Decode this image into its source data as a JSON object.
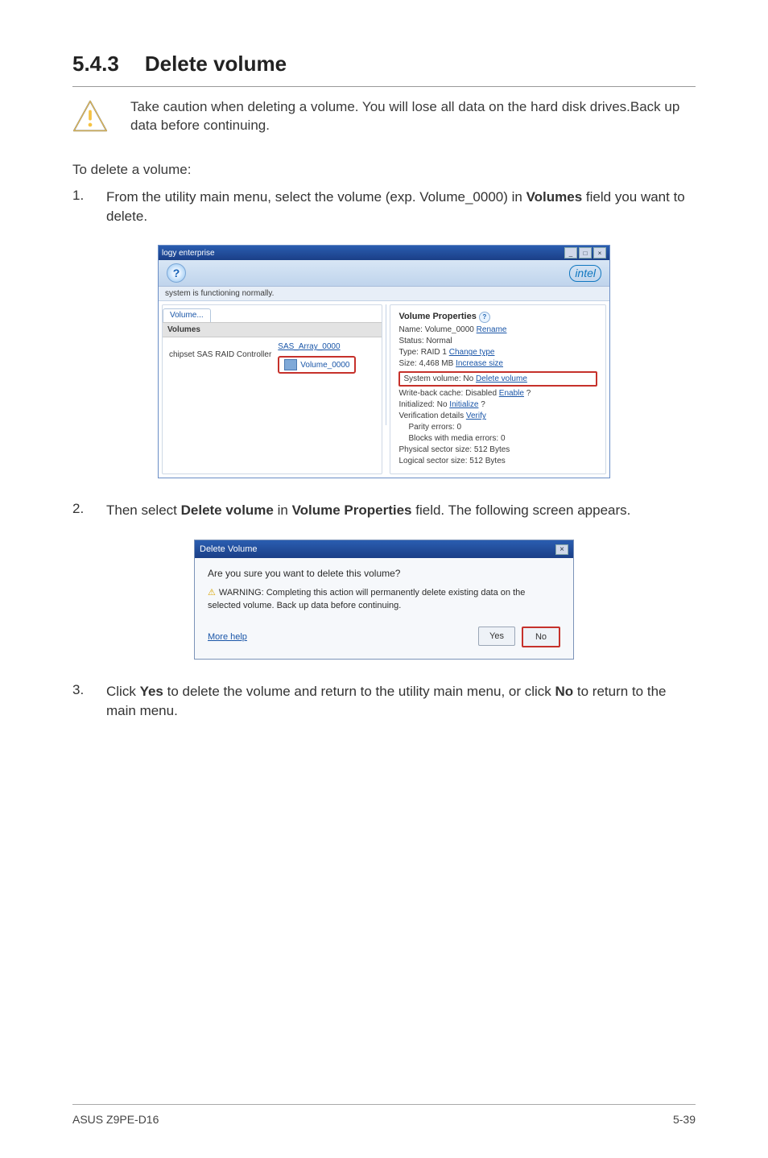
{
  "section": {
    "number": "5.4.3",
    "title": "Delete volume"
  },
  "note": {
    "text": "Take caution when deleting a volume. You will lose all data on the hard disk drives.Back up data before continuing."
  },
  "intro": "To delete a volume:",
  "step1": {
    "num": "1.",
    "text_pre": "From the utility main menu, select the volume (exp. Volume_0000) in ",
    "bold": "Volumes",
    "text_post": " field you want to delete."
  },
  "screenshot1": {
    "title": "logy enterprise",
    "brand": "intel",
    "status": "system is functioning normally.",
    "tab": "Volume...",
    "volumes_header": "Volumes",
    "controller_label": "chipset SAS RAID Controller",
    "array_link": "SAS_Array_0000",
    "volume_chip": "Volume_0000",
    "props": {
      "title": "Volume Properties",
      "name_label": "Name:",
      "name_value": "Volume_0000",
      "rename": "Rename",
      "status_label": "Status:",
      "status_value": "Normal",
      "type_label": "Type:",
      "type_value": "RAID 1",
      "change_type": "Change type",
      "size_label": "Size:",
      "size_value": "4,468 MB",
      "increase_size": "Increase size",
      "sysvol_label": "System volume:",
      "sysvol_value": "No",
      "delete_volume": "Delete volume",
      "wbc_label": "Write-back cache:",
      "wbc_value": "Disabled",
      "enable": "Enable",
      "init_label": "Initialized:",
      "init_value": "No",
      "initialize": "Initialize",
      "verif_label": "Verification details",
      "verify": "Verify",
      "parity": "Parity errors: 0",
      "blocks": "Blocks with media errors: 0",
      "phys": "Physical sector size: 512 Bytes",
      "log": "Logical sector size: 512 Bytes"
    }
  },
  "step2": {
    "num": "2.",
    "pre": "Then select ",
    "b1": "Delete volume",
    "mid": " in ",
    "b2": "Volume Properties",
    "post": " field. The following screen appears."
  },
  "dialog": {
    "title": "Delete Volume",
    "close": "×",
    "question": "Are you sure you want to delete this volume?",
    "warning": "WARNING: Completing this action will permanently delete existing data on the selected volume. Back up data before continuing.",
    "more": "More help",
    "yes": "Yes",
    "no": "No"
  },
  "step3": {
    "num": "3.",
    "p1": "Click ",
    "b1": "Yes",
    "p2": " to delete the volume and return to the utility main menu, or click ",
    "b2": "No",
    "p3": " to return to the main menu."
  },
  "footer": {
    "left": "ASUS Z9PE-D16",
    "right": "5-39"
  }
}
